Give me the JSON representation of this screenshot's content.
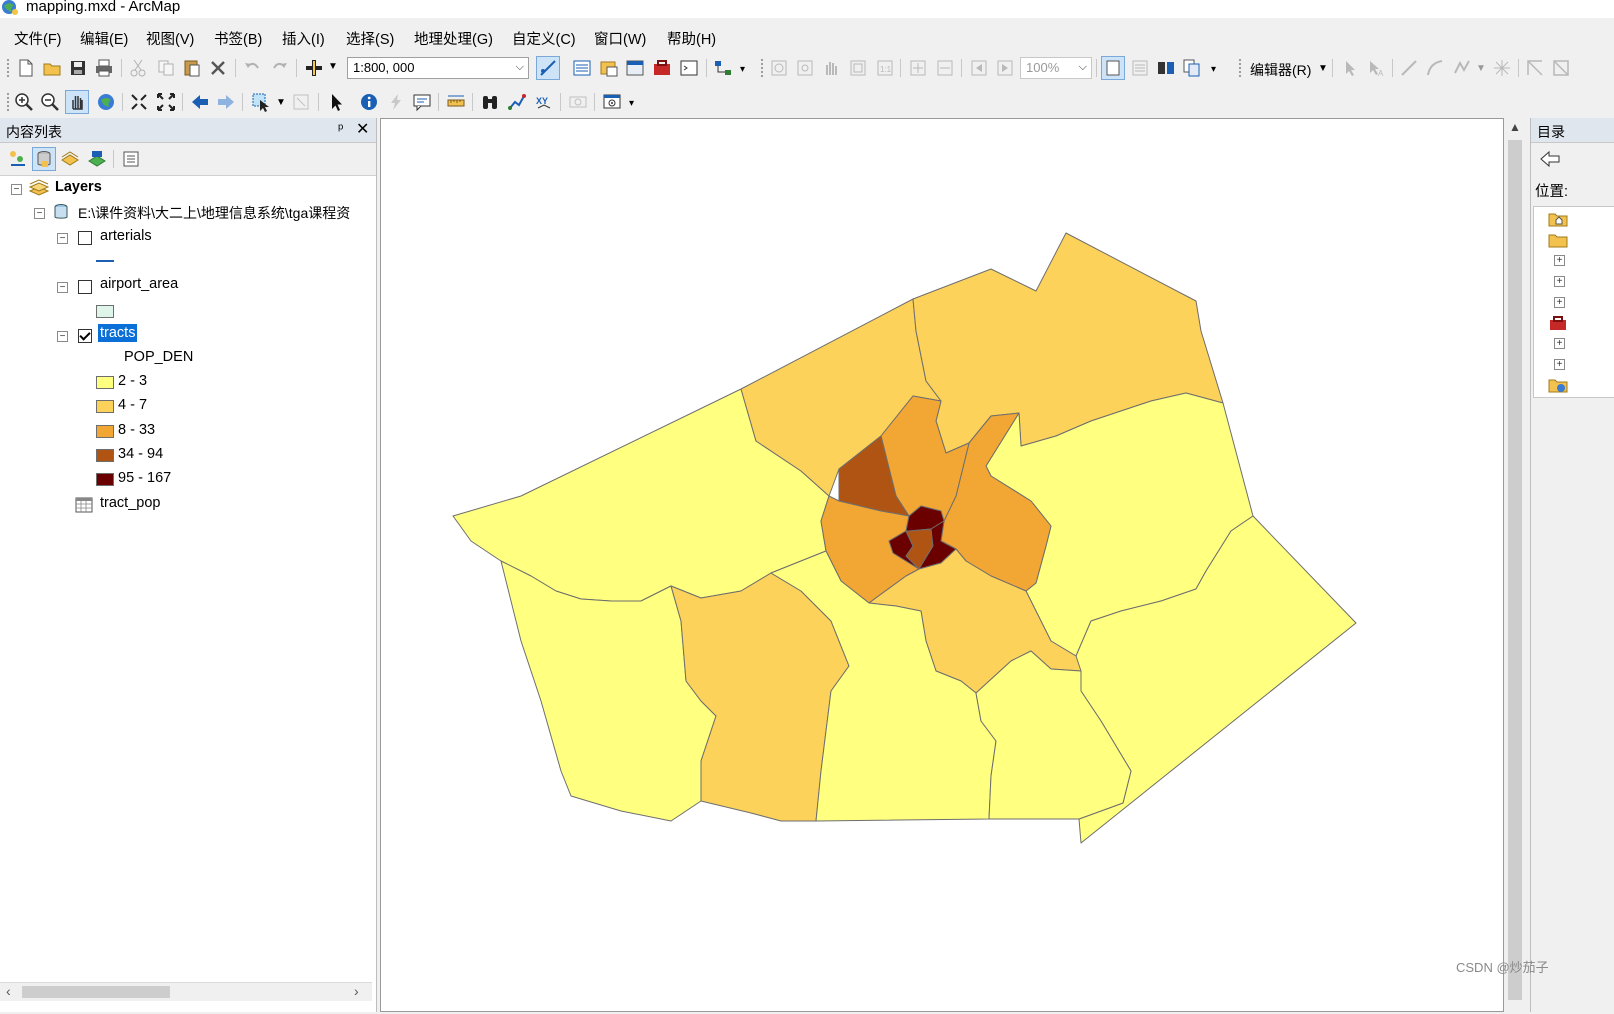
{
  "window": {
    "title": "mapping.mxd - ArcMap"
  },
  "menu": [
    "文件(F)",
    "编辑(E)",
    "视图(V)",
    "书签(B)",
    "插入(I)",
    "选择(S)",
    "地理处理(G)",
    "自定义(C)",
    "窗口(W)",
    "帮助(H)"
  ],
  "toolbar": {
    "scale_value": "1:800, 000",
    "zoom_value": "100%",
    "editor_label": "编辑器(R)"
  },
  "toc": {
    "title": "内容列表",
    "pin_glyph": "ᵖ",
    "close_glyph": "✕",
    "root_label": "Layers",
    "workspace_path": "E:\\课件资料\\大二上\\地理信息系统\\tga课程资",
    "layers": [
      {
        "name": "arterials",
        "checked": false
      },
      {
        "name": "airport_area",
        "checked": false
      },
      {
        "name": "tracts",
        "checked": true
      }
    ],
    "field_name": "POP_DEN",
    "legend": [
      {
        "label": "2 - 3",
        "color": "#ffff80"
      },
      {
        "label": "4 - 7",
        "color": "#fcd25a"
      },
      {
        "label": "8 - 33",
        "color": "#f2a634"
      },
      {
        "label": "34 - 94",
        "color": "#b05414"
      },
      {
        "label": "95 - 167",
        "color": "#6a0000"
      }
    ],
    "table_name": "tract_pop",
    "airport_color": "#dff5ea",
    "arterial_color": "#1a5fb4"
  },
  "catalog": {
    "title": "目录",
    "location_label": "位置:"
  },
  "watermark": "CSDN @炒茄子"
}
